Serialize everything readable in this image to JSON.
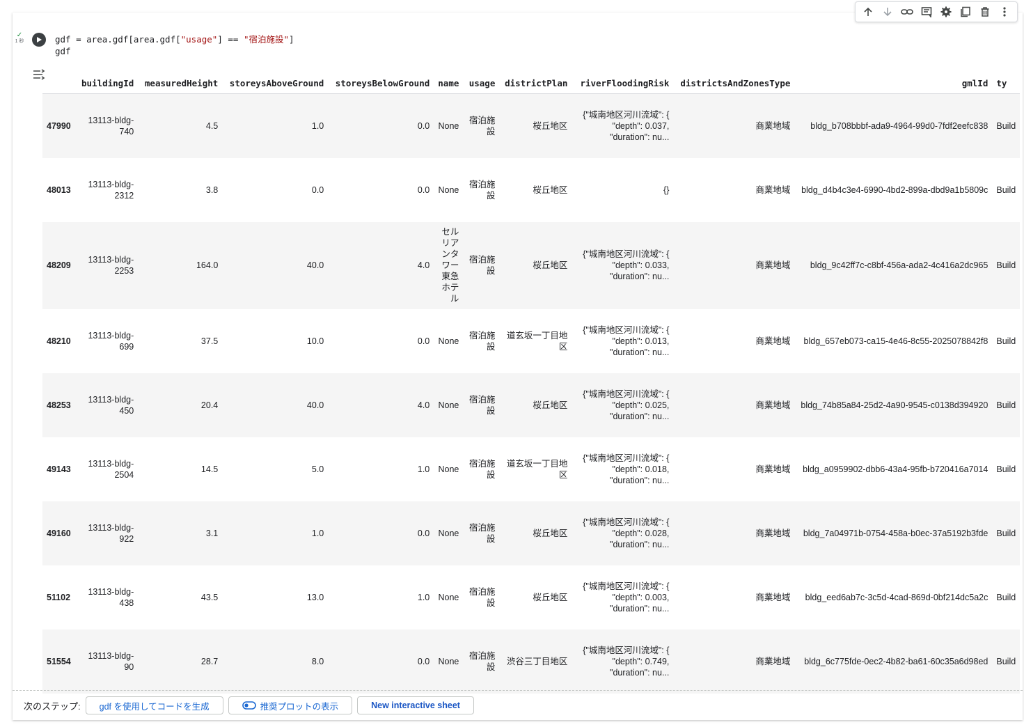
{
  "cell": {
    "exec_status": "✓",
    "exec_time": "1 秒",
    "code_lines": {
      "line1_a": "gdf = area.gdf[area.gdf[",
      "line1_str1": "\"usage\"",
      "line1_b": "] == ",
      "line1_str2": "\"宿泊施設\"",
      "line1_c": "]",
      "line2": "gdf"
    }
  },
  "toolbar": {
    "icons": [
      "arrow-up-icon",
      "arrow-down-icon",
      "link-icon",
      "comment-icon",
      "gear-icon",
      "mirror-cell-icon",
      "trash-icon",
      "more-vert-icon"
    ]
  },
  "table": {
    "columns": [
      "",
      "buildingId",
      "measuredHeight",
      "storeysAboveGround",
      "storeysBelowGround",
      "name",
      "usage",
      "districtPlan",
      "riverFloodingRisk",
      "districtsAndZonesType",
      "gmlId",
      "ty"
    ],
    "rows": [
      {
        "index": "47990",
        "buildingId": "13113-bldg-740",
        "measuredHeight": "4.5",
        "storeysAboveGround": "1.0",
        "storeysBelowGround": "0.0",
        "name": "None",
        "usage": "宿泊施設",
        "districtPlan": "桜丘地区",
        "riverFloodingRisk": "{\"城南地区河川流域\": { \"depth\": 0.037, \"duration\": nu...",
        "districtsAndZonesType": "商業地域",
        "gmlId": "bldg_b708bbbf-ada9-4964-99d0-7fdf2eefc838",
        "type": "Build"
      },
      {
        "index": "48013",
        "buildingId": "13113-bldg-2312",
        "measuredHeight": "3.8",
        "storeysAboveGround": "0.0",
        "storeysBelowGround": "0.0",
        "name": "None",
        "usage": "宿泊施設",
        "districtPlan": "桜丘地区",
        "riverFloodingRisk": "{}",
        "districtsAndZonesType": "商業地域",
        "gmlId": "bldg_d4b4c3e4-6990-4bd2-899a-dbd9a1b5809c",
        "type": "Build"
      },
      {
        "index": "48209",
        "buildingId": "13113-bldg-2253",
        "measuredHeight": "164.0",
        "storeysAboveGround": "40.0",
        "storeysBelowGround": "4.0",
        "name": "セルリアンタワー東急ホテル",
        "usage": "宿泊施設",
        "districtPlan": "桜丘地区",
        "riverFloodingRisk": "{\"城南地区河川流域\": { \"depth\": 0.033, \"duration\": nu...",
        "districtsAndZonesType": "商業地域",
        "gmlId": "bldg_9c42ff7c-c8bf-456a-ada2-4c416a2dc965",
        "type": "Build"
      },
      {
        "index": "48210",
        "buildingId": "13113-bldg-699",
        "measuredHeight": "37.5",
        "storeysAboveGround": "10.0",
        "storeysBelowGround": "0.0",
        "name": "None",
        "usage": "宿泊施設",
        "districtPlan": "道玄坂一丁目地区",
        "riverFloodingRisk": "{\"城南地区河川流域\": { \"depth\": 0.013, \"duration\": nu...",
        "districtsAndZonesType": "商業地域",
        "gmlId": "bldg_657eb073-ca15-4e46-8c55-2025078842f8",
        "type": "Build"
      },
      {
        "index": "48253",
        "buildingId": "13113-bldg-450",
        "measuredHeight": "20.4",
        "storeysAboveGround": "40.0",
        "storeysBelowGround": "4.0",
        "name": "None",
        "usage": "宿泊施設",
        "districtPlan": "桜丘地区",
        "riverFloodingRisk": "{\"城南地区河川流域\": { \"depth\": 0.025, \"duration\": nu...",
        "districtsAndZonesType": "商業地域",
        "gmlId": "bldg_74b85a84-25d2-4a90-9545-c0138d394920",
        "type": "Build"
      },
      {
        "index": "49143",
        "buildingId": "13113-bldg-2504",
        "measuredHeight": "14.5",
        "storeysAboveGround": "5.0",
        "storeysBelowGround": "1.0",
        "name": "None",
        "usage": "宿泊施設",
        "districtPlan": "道玄坂一丁目地区",
        "riverFloodingRisk": "{\"城南地区河川流域\": { \"depth\": 0.018, \"duration\": nu...",
        "districtsAndZonesType": "商業地域",
        "gmlId": "bldg_a0959902-dbb6-43a4-95fb-b720416a7014",
        "type": "Build"
      },
      {
        "index": "49160",
        "buildingId": "13113-bldg-922",
        "measuredHeight": "3.1",
        "storeysAboveGround": "1.0",
        "storeysBelowGround": "0.0",
        "name": "None",
        "usage": "宿泊施設",
        "districtPlan": "桜丘地区",
        "riverFloodingRisk": "{\"城南地区河川流域\": { \"depth\": 0.028, \"duration\": nu...",
        "districtsAndZonesType": "商業地域",
        "gmlId": "bldg_7a04971b-0754-458a-b0ec-37a5192b3fde",
        "type": "Build"
      },
      {
        "index": "51102",
        "buildingId": "13113-bldg-438",
        "measuredHeight": "43.5",
        "storeysAboveGround": "13.0",
        "storeysBelowGround": "1.0",
        "name": "None",
        "usage": "宿泊施設",
        "districtPlan": "桜丘地区",
        "riverFloodingRisk": "{\"城南地区河川流域\": { \"depth\": 0.003, \"duration\": nu...",
        "districtsAndZonesType": "商業地域",
        "gmlId": "bldg_eed6ab7c-3c5d-4cad-869d-0bf214dc5a2c",
        "type": "Build"
      },
      {
        "index": "51554",
        "buildingId": "13113-bldg-90",
        "measuredHeight": "28.7",
        "storeysAboveGround": "8.0",
        "storeysBelowGround": "0.0",
        "name": "None",
        "usage": "宿泊施設",
        "districtPlan": "渋谷三丁目地区",
        "riverFloodingRisk": "{\"城南地区河川流域\": { \"depth\": 0.749, \"duration\": nu...",
        "districtsAndZonesType": "商業地域",
        "gmlId": "bldg_6c775fde-0ec2-4b82-ba61-60c35a6d98ed",
        "type": "Build"
      }
    ]
  },
  "footer": {
    "label": "次のステップ:",
    "btn_generate": "gdf を使用してコードを生成",
    "btn_plots": "推奨プロットの表示",
    "btn_sheet": "New interactive sheet"
  }
}
